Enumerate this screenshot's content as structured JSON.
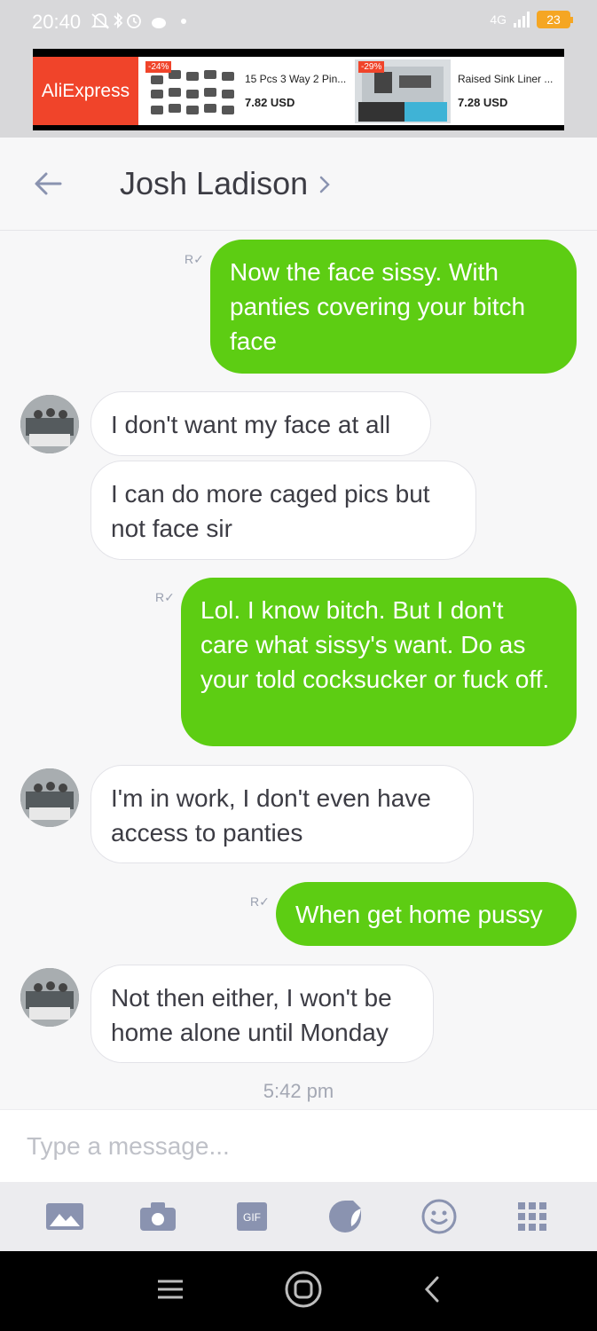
{
  "status_bar": {
    "time": "20:40",
    "network": "4G",
    "battery": "23"
  },
  "ad": {
    "brand": "AliExpress",
    "items": [
      {
        "badge": "-24%",
        "title": "15 Pcs 3 Way 2 Pin...",
        "price": "7.82 USD"
      },
      {
        "badge": "-29%",
        "title": "Raised Sink Liner ...",
        "price": "7.28 USD"
      }
    ]
  },
  "header": {
    "title": "Josh Ladison",
    "chevron": "›"
  },
  "messages": [
    {
      "dir": "out",
      "text": "Now the face sissy. With panties covering your bitch face"
    },
    {
      "dir": "in",
      "text": "I don't want my face at all"
    },
    {
      "dir": "in",
      "text": "I can do more caged pics but not face sir"
    },
    {
      "dir": "out",
      "text": "Lol. I know bitch. But I don't care what sissy's want. Do as your told cocksucker or fuck off."
    },
    {
      "dir": "in",
      "text": "I'm in work, I don't even have access to panties"
    },
    {
      "dir": "out",
      "text": "When get home pussy"
    },
    {
      "dir": "in",
      "text": "Not then either, I won't be home alone until Monday"
    }
  ],
  "read_mark": "R",
  "timestamp": "5:42 pm",
  "composer": {
    "placeholder": "Type a message..."
  },
  "toolbar": {
    "icons": [
      "image-icon",
      "camera-icon",
      "gif-icon",
      "sticker-icon",
      "emoji-icon",
      "apps-grid-icon"
    ],
    "gif_label": "GIF"
  },
  "colors": {
    "outgoing": "#5dcd13",
    "incoming": "#ffffff",
    "accent": "#f0442a"
  }
}
